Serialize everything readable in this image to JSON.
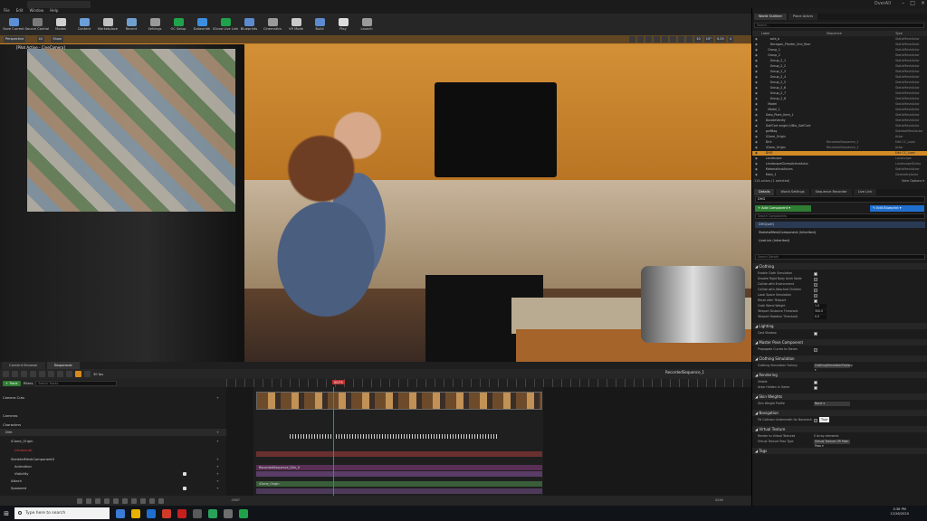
{
  "window": {
    "app_name": "OverAll"
  },
  "menu": [
    "File",
    "Edit",
    "Window",
    "Help"
  ],
  "toolbar": [
    {
      "label": "Save Current",
      "color": "#5b8fd6"
    },
    {
      "label": "Source Control",
      "color": "#7a7a7a"
    },
    {
      "label": "Modes",
      "color": "#d0d0d0"
    },
    {
      "label": "Content",
      "color": "#6a9fd8"
    },
    {
      "label": "Marketplace",
      "color": "#c0c0c0"
    },
    {
      "label": "Recent",
      "color": "#6fa0d0"
    },
    {
      "label": "Settings",
      "color": "#9a9a9a"
    },
    {
      "label": "OC Setup",
      "color": "#1fa34a"
    },
    {
      "label": "Datasmith",
      "color": "#3c8ee0"
    },
    {
      "label": "iClone Live Link",
      "color": "#1fa34a"
    },
    {
      "label": "Blueprints",
      "color": "#5d8bd0"
    },
    {
      "label": "Cinematics",
      "color": "#9a9a9a"
    },
    {
      "label": "VR Mode",
      "color": "#c9c9c9"
    },
    {
      "label": "Build",
      "color": "#5d8bd0"
    },
    {
      "label": "Play",
      "color": "#dddddd"
    },
    {
      "label": "Launch",
      "color": "#9a9a9a"
    }
  ],
  "viewport": {
    "chips": [
      "Perspective",
      "Lit",
      "Show"
    ],
    "pilot_label": "[Pilot Active - CineCamera]",
    "top_right": [
      "10",
      "10°",
      "0.25",
      "4"
    ]
  },
  "bottom_tabs": [
    "Content Browser",
    "Sequencer"
  ],
  "sequencer": {
    "fps": "30 fps",
    "sequence_name": "RecordedSequence_1",
    "track_button": "+ Track",
    "filters_label": "Filters",
    "search_placeholder": "Search Tracks",
    "playhead": "0073",
    "range_start": "-0087",
    "range_end": "0246",
    "range_end_outer": "0246+",
    "tracks": [
      {
        "label": "Camera Cuts",
        "indent": 3,
        "add": "+"
      },
      {
        "label": "Cameras",
        "indent": 3,
        "add": ""
      },
      {
        "label": "Characters",
        "indent": 3,
        "add": ""
      },
      {
        "label": "Dirk",
        "indent": 6,
        "add": "+"
      },
      {
        "label": "iClone_Origin",
        "indent": 12,
        "add": "+"
      },
      {
        "label": "(Unbound)",
        "indent": 16,
        "add": "",
        "red": true
      },
      {
        "label": "SkeletalMeshComponent0",
        "indent": 12,
        "add": "+"
      },
      {
        "label": "Animation",
        "indent": 16,
        "add": "+"
      },
      {
        "label": "Visibility",
        "indent": 16,
        "add": "+",
        "check": true
      },
      {
        "label": "Attach",
        "indent": 12,
        "add": "+"
      },
      {
        "label": "Spawned",
        "indent": 12,
        "add": "+",
        "check": true
      }
    ],
    "bars": [
      {
        "label": "",
        "color": "#6a3030"
      },
      {
        "label": "RecordedSequence_Dirk_0",
        "color": "#5a2f55"
      },
      {
        "label": "",
        "color": "#5a3d66"
      },
      {
        "label": "iClone_Origin",
        "color": "#3a5d3a"
      },
      {
        "label": "",
        "color": "#4d3a5a"
      }
    ]
  },
  "outliner": {
    "tabs": [
      "World Outliner",
      "Place Actors"
    ],
    "search_placeholder": "Search...",
    "columns": {
      "label": "Label",
      "sequence": "Sequence",
      "type": "Type"
    },
    "rows": [
      {
        "label": "sofa_b",
        "indent": 16,
        "sequence": "",
        "type": "StaticMeshActor"
      },
      {
        "label": "Decogan_Planter_2nd_floor",
        "indent": 16,
        "sequence": "",
        "type": "StaticMeshActor"
      },
      {
        "label": "Group_1",
        "indent": 12,
        "sequence": "",
        "type": "StaticMeshActor"
      },
      {
        "label": "Group_2",
        "indent": 12,
        "sequence": "",
        "type": "StaticMeshActor"
      },
      {
        "label": "Group_2_1",
        "indent": 16,
        "sequence": "",
        "type": "StaticMeshActor"
      },
      {
        "label": "Group_2_2",
        "indent": 16,
        "sequence": "",
        "type": "StaticMeshActor"
      },
      {
        "label": "Group_2_3",
        "indent": 16,
        "sequence": "",
        "type": "StaticMeshActor"
      },
      {
        "label": "Group_2_4",
        "indent": 16,
        "sequence": "",
        "type": "StaticMeshActor"
      },
      {
        "label": "Group_2_5",
        "indent": 16,
        "sequence": "",
        "type": "StaticMeshActor"
      },
      {
        "label": "Group_2_6",
        "indent": 16,
        "sequence": "",
        "type": "StaticMeshActor"
      },
      {
        "label": "Group_2_7",
        "indent": 16,
        "sequence": "",
        "type": "StaticMeshActor"
      },
      {
        "label": "Group_2_8",
        "indent": 16,
        "sequence": "",
        "type": "StaticMeshActor"
      },
      {
        "label": "Model",
        "indent": 12,
        "sequence": "",
        "type": "StaticMeshActor"
      },
      {
        "label": "Model_1",
        "indent": 12,
        "sequence": "",
        "type": "StaticMeshActor"
      },
      {
        "label": "Gato_Plant_Item_1",
        "indent": 8,
        "sequence": "",
        "type": "StaticMeshActor"
      },
      {
        "label": "DoubleVanity",
        "indent": 8,
        "sequence": "",
        "type": "StaticMeshActor"
      },
      {
        "label": "GolfCart single (UBio_GolfCart",
        "indent": 8,
        "sequence": "",
        "type": "StaticMeshActor"
      },
      {
        "label": "golfBag",
        "indent": 8,
        "sequence": "",
        "type": "SkeletalMeshActor"
      },
      {
        "label": "iClone_Origin",
        "indent": 8,
        "sequence": "",
        "type": "Actor"
      },
      {
        "label": "Dirk",
        "indent": 8,
        "sequence": "RecordedSequence_1",
        "type": "Edit CC_Load"
      },
      {
        "label": "iClone_Origin",
        "indent": 8,
        "sequence": "RecordedSequence_1",
        "type": "Actor"
      },
      {
        "label": "DHG",
        "indent": 8,
        "sequence": "",
        "type": "Edit CC_Load",
        "selected": true
      },
      {
        "label": "Landscape",
        "indent": 8,
        "sequence": "",
        "type": "Landscape"
      },
      {
        "label": "LandscapeGizmoActiveActor",
        "indent": 8,
        "sequence": "",
        "type": "LandscapeGizmo"
      },
      {
        "label": "MaterialInstActors",
        "indent": 8,
        "sequence": "",
        "type": "StaticMeshActor"
      },
      {
        "label": "Main_1",
        "indent": 8,
        "sequence": "",
        "type": "GeometryActor"
      }
    ],
    "footer": "114 actors (1 selected)",
    "view_options": "View Options ▾"
  },
  "details": {
    "tabs": [
      "Details",
      "World Settings",
      "Sequence Recorder",
      "Live Link"
    ],
    "name": "DHG",
    "add_component": "+ Add Component ▾",
    "edit_blueprint": "✎ Edit Blueprint ▾",
    "search_placeholder": "Search Components",
    "components": [
      "DHG(self)",
      "SkeletalMeshComponent (Inherited)",
      "LiveLink (Inherited)"
    ],
    "details_search": "Search Details",
    "sections": [
      {
        "title": "Clothing",
        "props": [
          {
            "label": "Enable Cloth Simulation",
            "kind": "check",
            "on": true
          },
          {
            "label": "Disable Rigid Body Anim Node",
            "kind": "check",
            "on": false
          },
          {
            "label": "Collide with Environment",
            "kind": "check",
            "on": false
          },
          {
            "label": "Collide with Attached Children",
            "kind": "check",
            "on": false
          },
          {
            "label": "Local Space Simulation",
            "kind": "check",
            "on": false
          },
          {
            "label": "Reset after Teleport",
            "kind": "check",
            "on": true
          },
          {
            "label": "Cloth Blend Weight",
            "kind": "num",
            "value": "1.0"
          },
          {
            "label": "Teleport Distance Threshold",
            "kind": "num",
            "value": "300.0"
          },
          {
            "label": "Teleport Rotation Threshold",
            "kind": "num",
            "value": "0.0"
          }
        ]
      },
      {
        "title": "Lighting",
        "props": [
          {
            "label": "Cast Shadow",
            "kind": "check",
            "on": true
          }
        ]
      },
      {
        "title": "Master Pose Component",
        "props": [
          {
            "label": "Propagate Curves to Slaves",
            "kind": "check",
            "on": false
          }
        ]
      },
      {
        "title": "Clothing Simulation",
        "props": [
          {
            "label": "Clothing Simulation Factory",
            "kind": "drop",
            "value": "ClothingSimulationFactory ▾"
          }
        ]
      },
      {
        "title": "Rendering",
        "props": [
          {
            "label": "Visible",
            "kind": "check",
            "on": true
          },
          {
            "label": "Actor Hidden In Game",
            "kind": "check",
            "on": true
          }
        ]
      },
      {
        "title": "Skin Weights",
        "props": [
          {
            "label": "Skin Weight Profile",
            "kind": "drop",
            "value": "None ▾"
          }
        ]
      },
      {
        "title": "Navigation",
        "props": [
          {
            "label": "Fill Collision Underneath for Navmesh",
            "kind": "check",
            "on": false
          }
        ]
      },
      {
        "title": "Virtual Texture",
        "props": [
          {
            "label": "Render to Virtual Textures",
            "kind": "text",
            "value": "0 Array elements"
          },
          {
            "label": "Virtual Texture Pass Type",
            "kind": "drop",
            "value": "Virtual Texture OR Main Pass ▾"
          }
        ]
      },
      {
        "title": "Tags",
        "props": []
      }
    ],
    "tooltip": "True"
  },
  "taskbar": {
    "search_placeholder": "Type here to search",
    "apps": [
      "#3a7bd5",
      "#e8b100",
      "#1e6fd0",
      "#d13b2a",
      "#c61f1f",
      "#5a5a5a",
      "#2aa35a",
      "#6e6e6e",
      "#1fa34a"
    ],
    "time": "3:36 PM",
    "date": "12/26/2020"
  }
}
